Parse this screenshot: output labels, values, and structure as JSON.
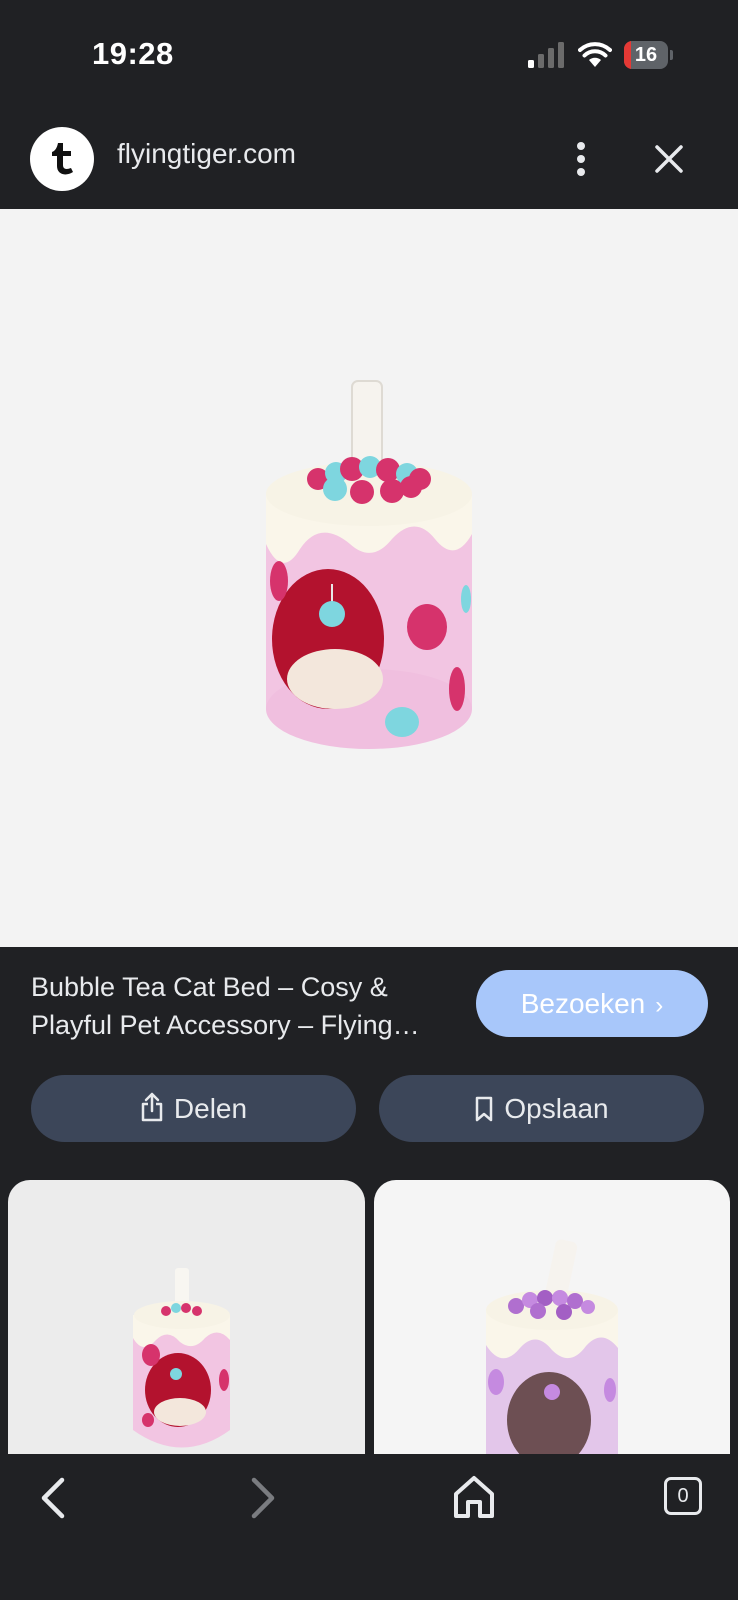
{
  "status_bar": {
    "time": "19:28",
    "battery_level": "16",
    "battery_fraction": 0.16,
    "signal_icon": "cellular-signal-icon",
    "wifi_icon": "wifi-icon"
  },
  "url_bar": {
    "site_logo_icon": "flying-tiger-logo-icon",
    "domain": "flyingtiger.com",
    "menu_icon": "more-vertical-icon",
    "close_icon": "close-icon"
  },
  "product": {
    "image_alt": "bubble-tea-cat-bed-image",
    "title": "Bubble Tea Cat Bed – Cosy & Playful Pet Accessory – Flying Tiger Copenhagen",
    "visit_label": "Bezoeken",
    "visit_chevron": "›",
    "share_label": "Delen",
    "save_label": "Opslaan"
  },
  "colors": {
    "background": "#202124",
    "visit_button": "#a8c7fa",
    "pill_button": "#3c4659",
    "image_background": "#f3f3f3"
  },
  "related": [
    {
      "thumb_icon": "pink-cat-bed-thumbnail"
    },
    {
      "thumb_icon": "purple-cat-bed-thumbnail"
    }
  ],
  "bottom_nav": {
    "back_icon": "chevron-left-icon",
    "forward_icon": "chevron-right-icon",
    "home_icon": "home-icon",
    "tab_count": "0"
  }
}
